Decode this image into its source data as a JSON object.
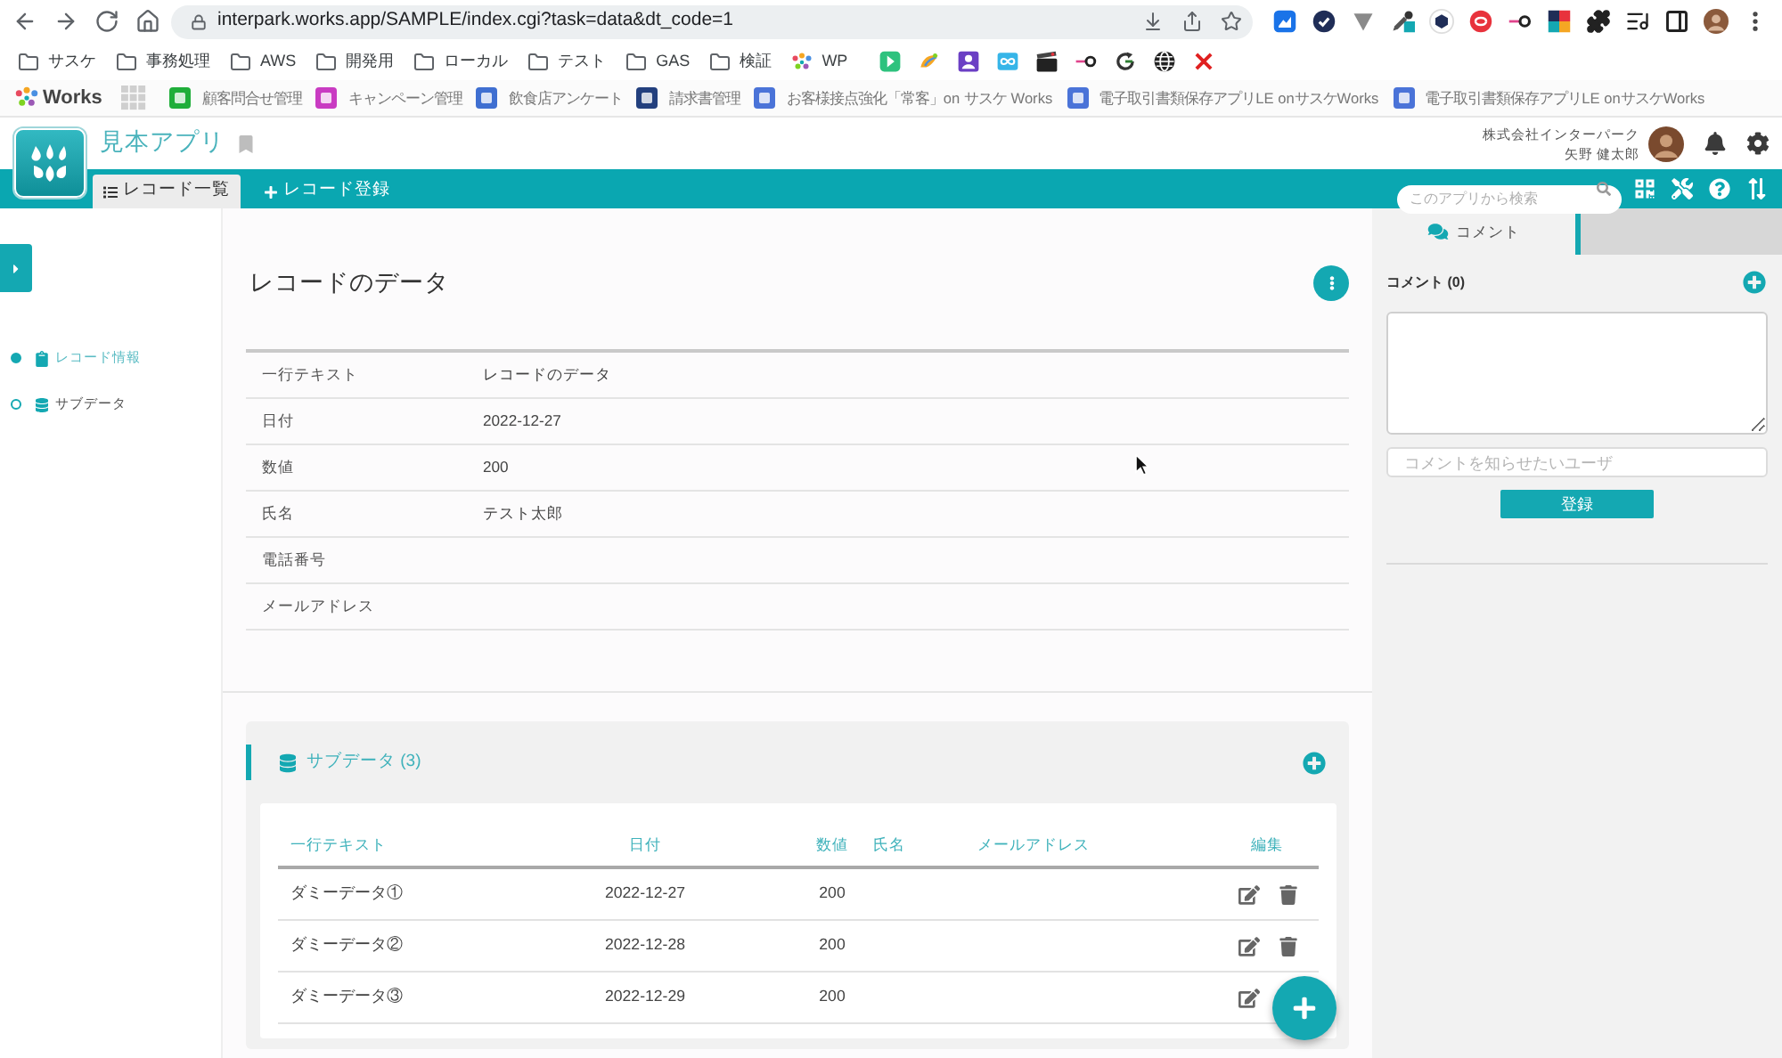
{
  "browser": {
    "url": "interpark.works.app/SAMPLE/index.cgi?task=data&dt_code=1",
    "bookmarks": [
      {
        "kind": "folder",
        "label": "サスケ"
      },
      {
        "kind": "folder",
        "label": "事務処理"
      },
      {
        "kind": "folder",
        "label": "AWS"
      },
      {
        "kind": "folder",
        "label": "開発用"
      },
      {
        "kind": "folder",
        "label": "ローカル"
      },
      {
        "kind": "folder",
        "label": "テスト"
      },
      {
        "kind": "folder",
        "label": "GAS"
      },
      {
        "kind": "folder",
        "label": "検証"
      },
      {
        "kind": "site",
        "label": "WP"
      }
    ]
  },
  "works_bar": {
    "logo": "Works",
    "apps": [
      "顧客問合せ管理",
      "キャンペーン管理",
      "飲食店アンケート",
      "請求書管理",
      "お客様接点強化「常客」on サスケ Works",
      "電子取引書類保存アプリLE onサスケWorks",
      "電子取引書類保存アプリLE onサスケWorks"
    ]
  },
  "app_header": {
    "title": "見本アプリ",
    "company": "株式会社インターパーク",
    "user": "矢野 健太郎"
  },
  "nav_tabs": [
    {
      "label": "レコード一覧",
      "selected": true
    },
    {
      "label": "レコード登録",
      "selected": false
    }
  ],
  "search": {
    "placeholder": "このアプリから検索"
  },
  "sidebar": {
    "items": [
      {
        "label": "レコード情報",
        "selected": true
      },
      {
        "label": "サブデータ",
        "selected": false
      }
    ]
  },
  "record": {
    "title": "レコードのデータ",
    "fields": [
      {
        "label": "一行テキスト",
        "value": "レコードのデータ"
      },
      {
        "label": "日付",
        "value": "2022-12-27"
      },
      {
        "label": "数値",
        "value": "200"
      },
      {
        "label": "氏名",
        "value": "テスト太郎"
      },
      {
        "label": "電話番号"
      },
      {
        "label": "メールアドレス"
      }
    ]
  },
  "subdata": {
    "title": "サブデータ (3)",
    "columns": [
      "一行テキスト",
      "日付",
      "数値",
      "氏名",
      "メールアドレス",
      "編集"
    ],
    "rows": [
      {
        "text": "ダミーデータ①",
        "date": "2022-12-27",
        "number": "200"
      },
      {
        "text": "ダミーデータ②",
        "date": "2022-12-28",
        "number": "200"
      },
      {
        "text": "ダミーデータ③",
        "date": "2022-12-29",
        "number": "200"
      }
    ]
  },
  "comments": {
    "tabs": [
      {
        "label": "コメント",
        "selected": true
      }
    ],
    "heading": "コメント (0)",
    "notify_placeholder": "コメントを知らせたいユーザ",
    "submit": "登録"
  }
}
